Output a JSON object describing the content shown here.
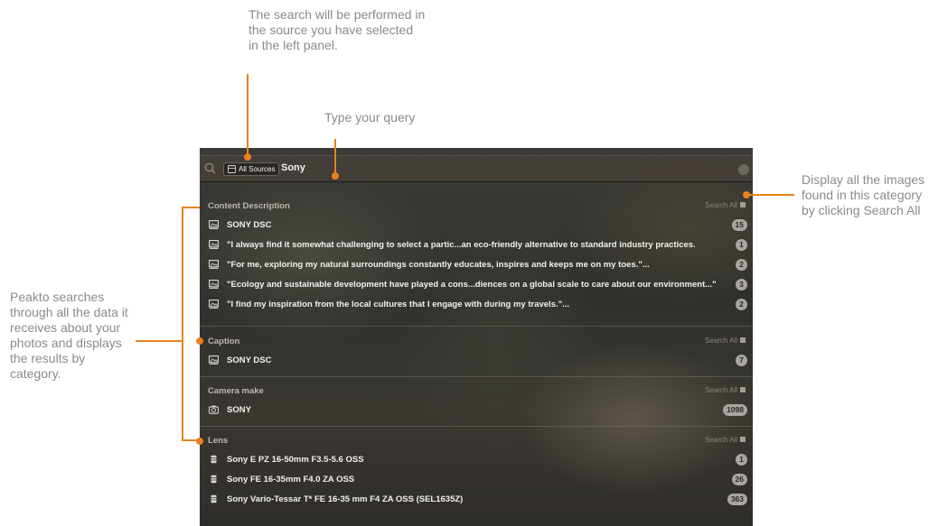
{
  "annotations": {
    "top": "The search will be performed in\nthe source you have selected\nin the left panel.",
    "query": "Type your query",
    "right": "Display all the images\nfound in this category\nby clicking Search All",
    "left": "Peakto searches\nthrough all the data it\nreceives about your\nphotos and displays\nthe results by\ncategory."
  },
  "colors": {
    "accent": "#e8821e"
  },
  "search": {
    "source": "All Sources",
    "query": "Sony"
  },
  "search_all_label": "Search All",
  "sections": [
    {
      "title": "Content Description",
      "icon": "image-icon",
      "items": [
        {
          "text": "SONY DSC",
          "count": "15"
        },
        {
          "text": "\"I always find it somewhat challenging to select a partic...an eco-friendly alternative to standard industry practices.",
          "count": "1"
        },
        {
          "text": "\"For me, exploring my natural surroundings constantly educates, inspires and keeps me on my toes.\"...",
          "count": "2"
        },
        {
          "text": "\"Ecology and sustainable development have played a cons...diences on a global scale to care about our environment...\"",
          "count": "3"
        },
        {
          "text": "\"I find my inspiration from the local cultures that I engage with during my travels.\"...",
          "count": "2"
        }
      ]
    },
    {
      "title": "Caption",
      "icon": "image-icon",
      "items": [
        {
          "text": "SONY DSC",
          "count": "7"
        }
      ]
    },
    {
      "title": "Camera make",
      "icon": "camera-icon",
      "items": [
        {
          "text": "SONY",
          "count": "1098"
        }
      ]
    },
    {
      "title": "Lens",
      "icon": "lens-icon",
      "items": [
        {
          "text": "Sony E PZ 16-50mm F3.5-5.6 OSS",
          "count": "1"
        },
        {
          "text": "Sony FE 16-35mm F4.0 ZA OSS",
          "count": "26"
        },
        {
          "text": "Sony Vario-Tessar T* FE 16-35 mm F4 ZA OSS (SEL1635Z)",
          "count": "363"
        }
      ]
    }
  ]
}
